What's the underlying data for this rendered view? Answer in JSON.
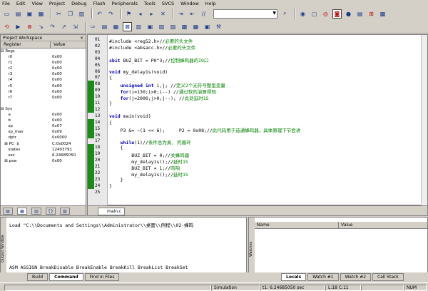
{
  "menu": [
    "File",
    "Edit",
    "View",
    "Project",
    "Debug",
    "Flash",
    "Peripherals",
    "Tools",
    "SVCS",
    "Window",
    "Help"
  ],
  "workspace": {
    "title": "Project Workspace",
    "close": "×",
    "col_register": "Register",
    "col_value": "Value",
    "rows": [
      {
        "name": "⊟ Regs",
        "value": ""
      },
      {
        "name": "      r0",
        "value": "0x00"
      },
      {
        "name": "      r1",
        "value": "0x00"
      },
      {
        "name": "      r2",
        "value": "0x00"
      },
      {
        "name": "      r3",
        "value": "0x00"
      },
      {
        "name": "      r4",
        "value": "0x00"
      },
      {
        "name": "      r5",
        "value": "0x00"
      },
      {
        "name": "      r6",
        "value": "0x00"
      },
      {
        "name": "      r7",
        "value": "0x00"
      },
      {
        "name": "",
        "value": ""
      },
      {
        "name": "⊟ Sys",
        "value": ""
      },
      {
        "name": "      a",
        "value": "0x00"
      },
      {
        "name": "      b",
        "value": "0x00"
      },
      {
        "name": "      sp",
        "value": "0x07"
      },
      {
        "name": "      sp_max",
        "value": "0x09"
      },
      {
        "name": "      dptr",
        "value": "0x0000"
      },
      {
        "name": "   ⊞ PC  $",
        "value": "C:0x0024"
      },
      {
        "name": "      states",
        "value": "12403791"
      },
      {
        "name": "      sec",
        "value": "6.24685050"
      },
      {
        "name": "   ⊞ psw",
        "value": "0x00"
      }
    ]
  },
  "editor": {
    "lines": [
      {
        "no": "01",
        "text": "#include <reg52.h>//",
        "comment": "必要的头文件"
      },
      {
        "no": "02",
        "text": "#include <absacc.h>//",
        "comment": "必要的头文件"
      },
      {
        "no": "03",
        "text": "",
        "comment": ""
      },
      {
        "no": "04",
        "text": "sbit BUZ_BIT = P0^3;//",
        "comment": "控制蜂鸣器的IO口"
      },
      {
        "no": "05",
        "text": "",
        "comment": ""
      },
      {
        "no": "06",
        "text": "void my_delay1s(void)",
        "comment": ""
      },
      {
        "no": "07",
        "text": "{",
        "comment": ""
      },
      {
        "no": "08",
        "text": "    unsigned int i,j; //",
        "comment": "定义2个无符号整型变量"
      },
      {
        "no": "09",
        "text": "    for(i=130;i>0;i--) //",
        "comment": "通过软的演算得知"
      },
      {
        "no": "10",
        "text": "    for(j=2000;j>0;j--); //",
        "comment": "此处延时1S"
      },
      {
        "no": "11",
        "text": "}",
        "comment": ""
      },
      {
        "no": "12",
        "text": "",
        "comment": ""
      },
      {
        "no": "13",
        "text": "void main(void)",
        "comment": ""
      },
      {
        "no": "14",
        "text": "{",
        "comment": ""
      },
      {
        "no": "15",
        "text": "    P3 &= ~(1 << 6);     P2 = 0x08;//",
        "comment": "此代码用于选通蜂鸣器，具体原理下节会讲"
      },
      {
        "no": "16",
        "text": "",
        "comment": ""
      },
      {
        "no": "17",
        "text": "    while(1)//",
        "comment": "条件总为真, 死循环"
      },
      {
        "no": "18",
        "text": "    {",
        "comment": ""
      },
      {
        "no": "19",
        "text": "        BUZ_BIT = 0;//",
        "comment": "关蜂鸣器"
      },
      {
        "no": "20",
        "text": "        my_delay1s();//",
        "comment": "延时1S"
      },
      {
        "no": "21",
        "text": "        BUZ_BIT = 1;//",
        "comment": "鸣响"
      },
      {
        "no": "22",
        "text": "        my_delay1s();//",
        "comment": "延时1S"
      },
      {
        "no": "23",
        "text": "    }",
        "comment": ""
      },
      {
        "no": "24",
        "text": "}",
        "comment": ""
      },
      {
        "no": "25",
        "text": "",
        "comment": ""
      }
    ],
    "file_tab": "main.c"
  },
  "output": {
    "side_label": "Output Window",
    "line1": "Load \"C:\\\\Documents and Settings\\\\Administrator\\\\桌面\\\\例程\\\\02-蜂鸣",
    "line2": "ASM ASSIGN BreakDisable BreakEnable BreakKill BreakList BreakSet",
    "tabs": [
      "Build",
      "Command",
      "Find in Files"
    ]
  },
  "watch": {
    "side_label": "Watches",
    "col_name": "Name",
    "col_value": "Value",
    "tabs": [
      "Locals",
      "Watch #1",
      "Watch #2",
      "Call Stack"
    ]
  },
  "status": {
    "mode": "Simulation",
    "time": "t1: 6.24685050 sec",
    "pos": "L:18 C:11",
    "num": "NUM"
  },
  "colors": {
    "coverage": "#1a8c1a",
    "keyword": "#0000c0",
    "comment": "#008000"
  }
}
